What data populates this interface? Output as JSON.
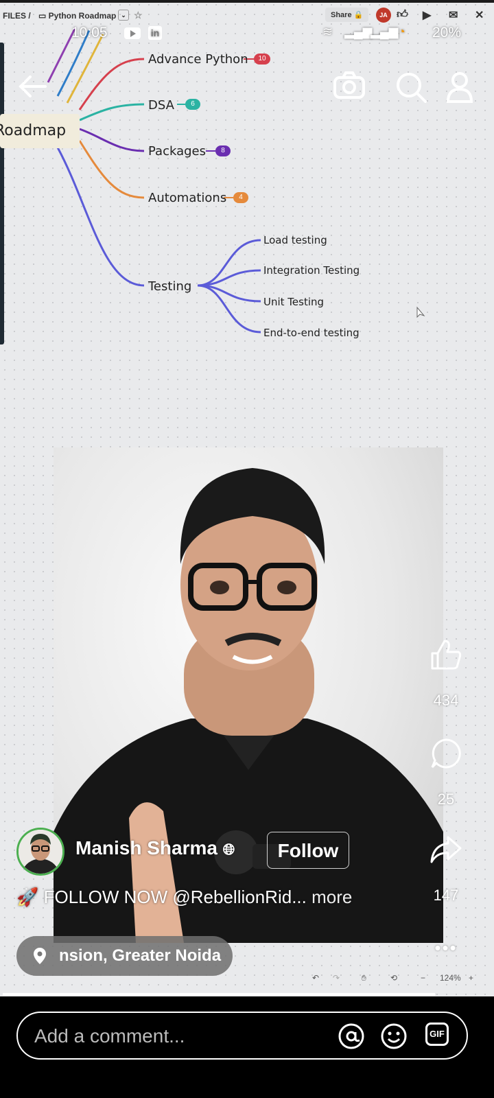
{
  "browser_tab": {
    "breadcrumb": "FILES /",
    "board_name": "Python Roadmap",
    "share_label": "Share",
    "avatar_initials": "JA"
  },
  "status_bar": {
    "time": "10:05",
    "battery": "20%"
  },
  "mindmap": {
    "root": "Roadmap",
    "branches": [
      {
        "label": "Advance Python",
        "count": "10",
        "color": "#d6404d"
      },
      {
        "label": "DSA",
        "count": "6",
        "color": "#2bb3a3"
      },
      {
        "label": "Packages",
        "count": "8",
        "color": "#6a2eb0"
      },
      {
        "label": "Automations",
        "count": "4",
        "color": "#e58a3c"
      },
      {
        "label": "Testing",
        "color": "#5b5bd8"
      }
    ],
    "testing_children": [
      "Load testing",
      "Integration Testing",
      "Unit Testing",
      "End-to-end testing"
    ]
  },
  "reel": {
    "likes": "434",
    "comments": "25",
    "shares": "147",
    "author": "Manish Sharma",
    "follow_label": "Follow",
    "caption": "FOLLOW NOW @RebellionRid...",
    "more_label": "more",
    "location": "nsion, Greater Noida"
  },
  "whiteboard_toolbar": {
    "zoom": "124%"
  },
  "comment_bar": {
    "placeholder": "Add a comment...",
    "gif_label": "GIF"
  }
}
